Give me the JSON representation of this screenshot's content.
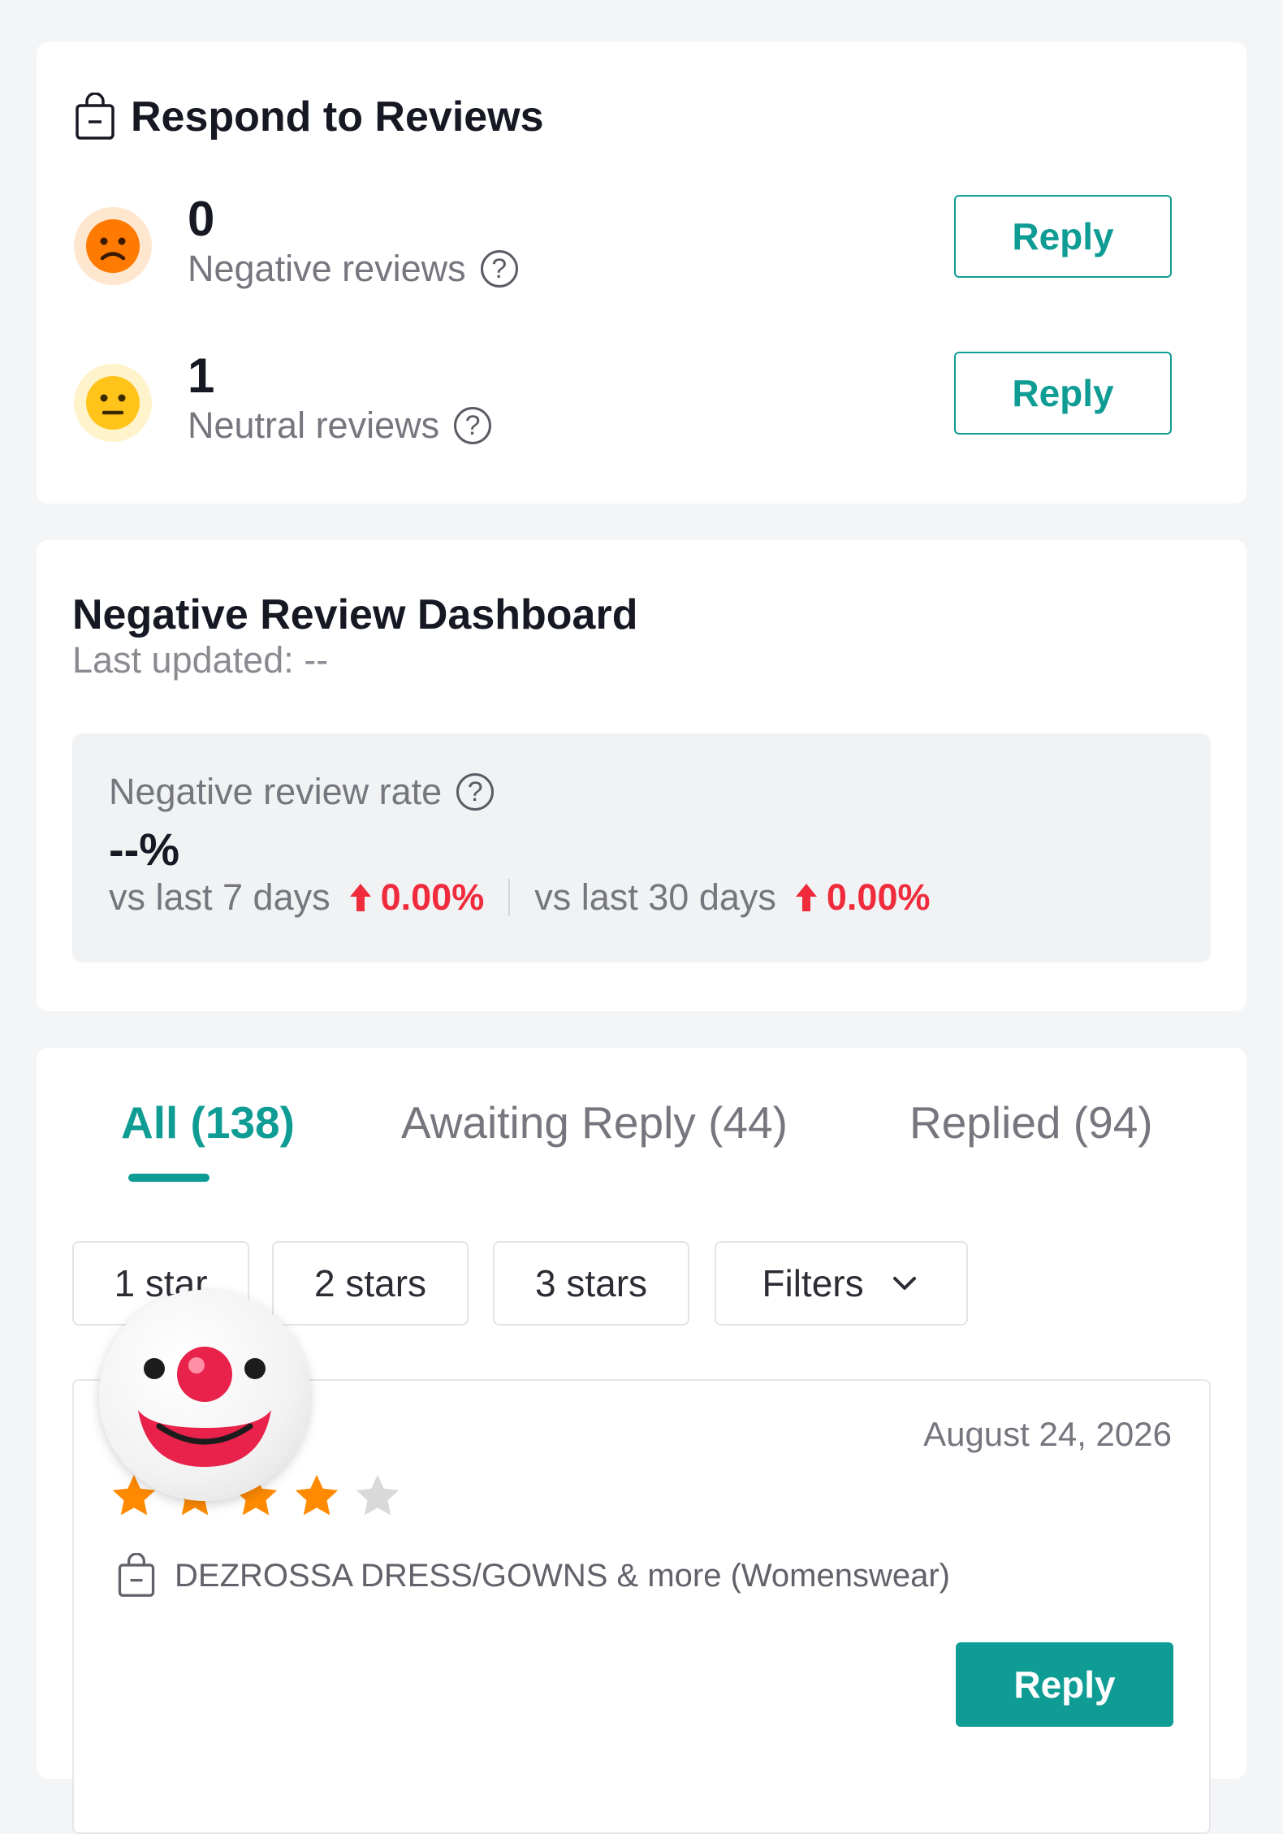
{
  "respond": {
    "title": "Respond to Reviews",
    "icon": "shopping-bag-icon",
    "negative": {
      "count": "0",
      "label": "Negative reviews",
      "reply_label": "Reply",
      "face_color": "#ff7a00"
    },
    "neutral": {
      "count": "1",
      "label": "Neutral reviews",
      "reply_label": "Reply",
      "face_color": "#ffc31a"
    }
  },
  "dashboard": {
    "title": "Negative Review Dashboard",
    "updated": "Last updated: --",
    "rate_label": "Negative review rate",
    "rate_value": "--%",
    "vs7_label": "vs last 7 days",
    "vs7_value": "0.00%",
    "vs30_label": "vs last 30 days",
    "vs30_value": "0.00%"
  },
  "tabs": [
    {
      "label": "All (138)",
      "active": true
    },
    {
      "label": "Awaiting Reply (44)",
      "active": false
    },
    {
      "label": "Replied (94)",
      "active": false
    }
  ],
  "filters": {
    "chips": [
      "1 star",
      "2 stars",
      "3 stars"
    ],
    "filters_label": "Filters"
  },
  "review": {
    "date": "August 24, 2026",
    "rating": 4,
    "max_rating": 5,
    "product": "DEZROSSA DRESS/GOWNS & more (Womenswear)",
    "reply_label": "Reply"
  },
  "colors": {
    "accent": "#0f9c94",
    "up_red": "#ef2b3c",
    "star": "#ff8a00",
    "star_empty": "#d9d9d9"
  }
}
